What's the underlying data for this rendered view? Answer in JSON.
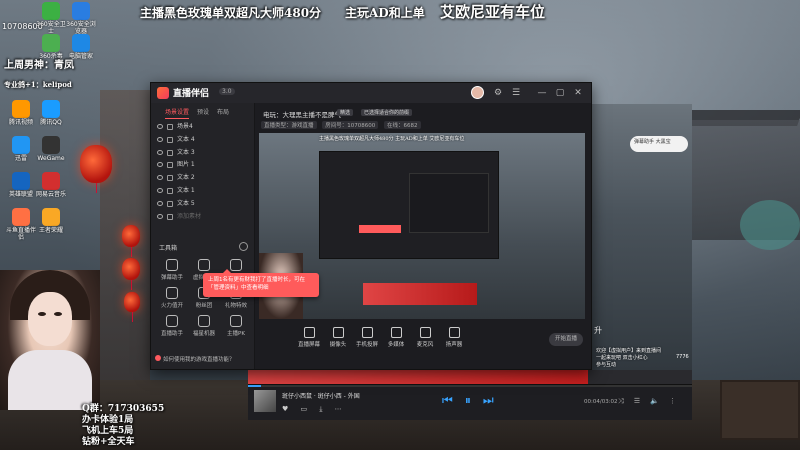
{
  "overlay": {
    "line1": "主播黑色玫瑰单双超凡大师480分",
    "line2": "主玩AD和上单",
    "line3": "艾欧尼亚有车位"
  },
  "desktop": {
    "qq_number": "10708600",
    "icons": [
      "360安全卫士",
      "360安全浏览器",
      "360杀毒",
      "电脑管家",
      "腾讯视频",
      "腾讯QQ",
      "迅雷",
      "WeGame",
      "英雄联盟",
      "网易云音乐",
      "斗鱼直播伴侣",
      "王者荣耀"
    ],
    "last_week_label": "上周男神：青凤",
    "kelipod": "专业鸽+1：kelipod"
  },
  "stream_info": {
    "qq_group": "Q群：717303655",
    "line2": "办卡体验1局",
    "line3": "飞机上车5局",
    "line4": "钻粉+全天车"
  },
  "app": {
    "name": "直播伴侣",
    "version": "3.0",
    "sidebar": {
      "tabs": [
        "场景设置",
        "预设",
        "布局"
      ],
      "scenes": [
        {
          "label": "场景4",
          "dim": false
        },
        {
          "label": "文本 4",
          "dim": false
        },
        {
          "label": "文本 3",
          "dim": false
        },
        {
          "label": "图片 1",
          "dim": false
        },
        {
          "label": "文本 2",
          "dim": false
        },
        {
          "label": "文本 1",
          "dim": false
        },
        {
          "label": "文本 5",
          "dim": false
        },
        {
          "label": "添加素材",
          "dim": true
        }
      ],
      "tools_title": "工具箱",
      "tools": [
        "弹幕助手",
        "虚拟形象",
        "水印设置",
        "火力值开",
        "粉丝团",
        "礼物特效",
        "直播助手",
        "福星机器",
        "主播PK"
      ],
      "tooltip": "上周1名有更有财我打了直播时长，可在「管理资料」中查看明细",
      "footer": "如何使用我的游戏直播功能？"
    },
    "main": {
      "title": "电玩：大理黑主播不是脾气",
      "tag1": "精选",
      "tag2": "已选择适合你的前缀",
      "row2_chips": [
        "直播类型：游戏直播",
        "房间号：10708600",
        "在线：6682"
      ],
      "preview_text": "主播黑色玫瑰单双超凡大师480分   主玩AD和上单   艾欧尼亚有车位",
      "toolbar": [
        "直播屏幕",
        "摄像头",
        "手机投屏",
        "多媒体",
        "麦克风",
        "扬声器"
      ],
      "start_button": "开始直播"
    }
  },
  "right_panel": {
    "bubble": "弹幕助手 大黑宝",
    "up_text": "升",
    "chat": "欢迎【虚拟用户】来到直播间\n一起来玩吧 双击小红心\n参与互动",
    "count": "7776"
  },
  "player": {
    "title": "斑仔小西鼠 · 斑仔小西 - 外国",
    "time": "00:04/03:02",
    "progress": 0.03
  },
  "colors": {
    "accent": "#ff5a5f",
    "player_blue": "#38a3ff",
    "banner_red": "#e04545"
  }
}
